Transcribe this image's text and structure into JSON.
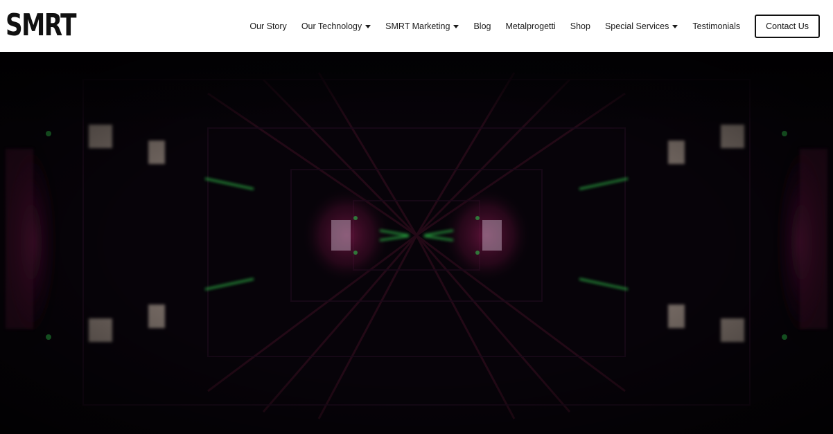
{
  "brand": {
    "logo_text": "SMRT"
  },
  "nav": {
    "items": [
      {
        "label": "Our Story",
        "dropdown": false
      },
      {
        "label": "Our Technology",
        "dropdown": true
      },
      {
        "label": "SMRT Marketing",
        "dropdown": true
      },
      {
        "label": "Blog",
        "dropdown": false
      },
      {
        "label": "Metalprogetti",
        "dropdown": false
      },
      {
        "label": "Shop",
        "dropdown": false
      },
      {
        "label": "Special Services",
        "dropdown": true
      },
      {
        "label": "Testimonials",
        "dropdown": false
      }
    ],
    "cta_label": "Contact Us"
  },
  "hero": {
    "background": "#060208",
    "accent_magenta": "#8a1a50",
    "accent_green": "#2fbf4a"
  }
}
